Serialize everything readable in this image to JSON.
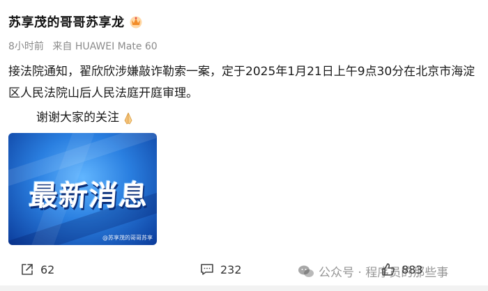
{
  "post": {
    "author": "苏享茂的哥哥苏享龙",
    "time": "8小时前",
    "source": "来自 HUAWEI Mate 60",
    "text_line1": "接法院通知，翟欣欣涉嫌敲诈勒索一案，定于2025年1月21日上午9点30分在北京市海淀区人民法院山后人民法庭开庭审理。",
    "text_line2": "谢谢大家的关注",
    "media": {
      "headline": "最新消息",
      "watermark": "@苏享茂的哥哥苏享"
    }
  },
  "actions": {
    "share_count": "62",
    "comment_count": "232",
    "like_count": "883"
  },
  "watermark": {
    "text": "公众号 · 程序员的那些事"
  },
  "icons": [
    "crown-icon",
    "pray-hands-icon",
    "share-icon",
    "comment-icon",
    "like-icon",
    "wechat-icon"
  ],
  "colors": {
    "meta_gray": "#8a8a8a",
    "media_blue": "#2a7fe0"
  }
}
